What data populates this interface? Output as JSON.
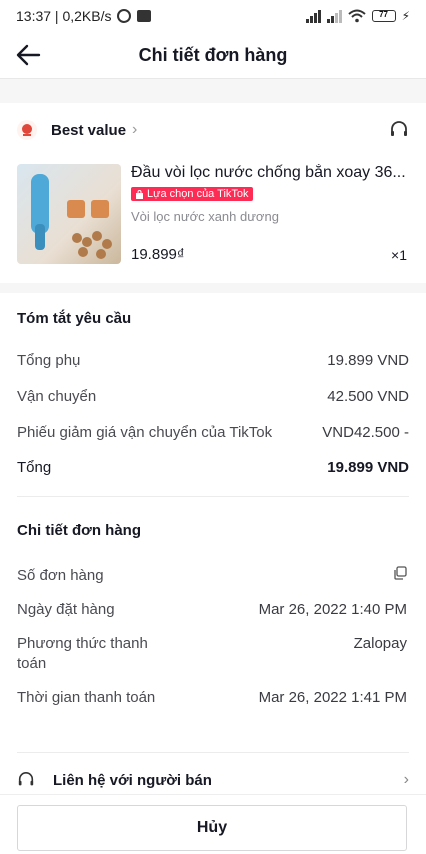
{
  "status_bar": {
    "time_network": "13:37 | 0,2KB/s",
    "battery": "77"
  },
  "header": {
    "title": "Chi tiết đơn hàng"
  },
  "seller": {
    "name": "Best value"
  },
  "product": {
    "title": "Đầu vòi lọc nước chống bắn xoay 36...",
    "badge": "Lựa chọn của TikTok",
    "variant": "Vòi lọc nước xanh dương",
    "price": "19.899₫",
    "quantity": "×1"
  },
  "summary": {
    "title": "Tóm tắt yêu cầu",
    "rows": [
      {
        "label": "Tổng phụ",
        "value": "19.899 VND"
      },
      {
        "label": "Vận chuyển",
        "value": "42.500 VND"
      },
      {
        "label": "Phiếu giảm giá vận chuyển của TikTok",
        "value": "VND42.500 -"
      }
    ],
    "total": {
      "label": "Tổng",
      "value": "19.899 VND"
    }
  },
  "details": {
    "title": "Chi tiết đơn hàng",
    "order_number_label": "Số đơn hàng",
    "order_date_label": "Ngày đặt hàng",
    "order_date_value": "Mar 26, 2022 1:40 PM",
    "payment_method_label": "Phương thức thanh toán",
    "payment_method_value": "Zalopay",
    "payment_time_label": "Thời gian thanh toán",
    "payment_time_value": "Mar 26, 2022 1:41 PM"
  },
  "contact": {
    "label": "Liên hệ với người bán"
  },
  "actions": {
    "cancel_label": "Hủy"
  }
}
